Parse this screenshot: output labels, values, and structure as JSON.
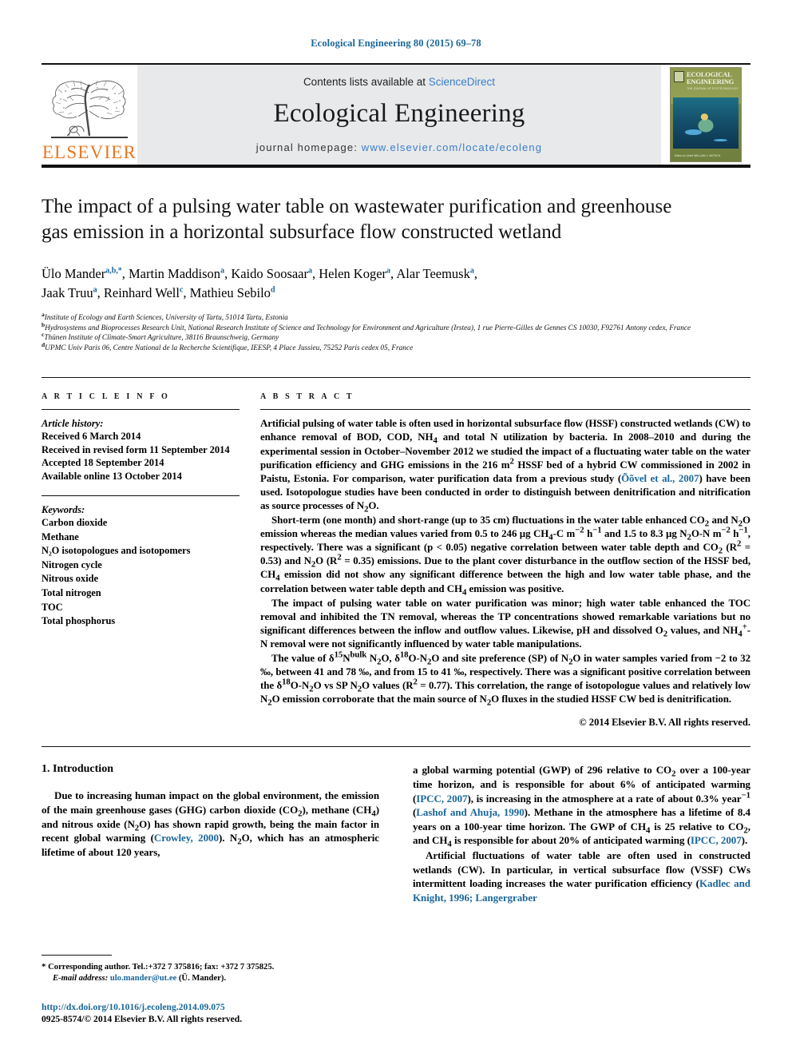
{
  "running_head": "Ecological Engineering 80 (2015) 69–78",
  "masthead": {
    "publisher_name": "ELSEVIER",
    "contents_prefix": "Contents lists available at ",
    "contents_link": "ScienceDirect",
    "journal_title": "Ecological Engineering",
    "homepage_prefix": "journal homepage: ",
    "homepage_url": "www.elsevier.com/locate/ecoleng",
    "cover": {
      "title_line1": "ECOLOGICAL",
      "title_line2": "ENGINEERING",
      "subtitle": "THE JOURNAL OF ECOTECHNOLOGY",
      "footer": "Editor-in-Chief\nWILLIAM J. MITSCH"
    }
  },
  "article": {
    "title": "The impact of a pulsing water table on wastewater purification and greenhouse gas emission in a horizontal subsurface flow constructed wetland",
    "authors": [
      {
        "name": "Ülo Mander",
        "marks": "a,b,*"
      },
      {
        "name": "Martin Maddison",
        "marks": "a"
      },
      {
        "name": "Kaido Soosaar",
        "marks": "a"
      },
      {
        "name": "Helen Koger",
        "marks": "a"
      },
      {
        "name": "Alar Teemusk",
        "marks": "a"
      },
      {
        "name": "Jaak Truu",
        "marks": "a"
      },
      {
        "name": "Reinhard Well",
        "marks": "c"
      },
      {
        "name": "Mathieu Sebilo",
        "marks": "d"
      }
    ],
    "affiliations": [
      {
        "mark": "a",
        "text": "Institute of Ecology and Earth Sciences, University of Tartu, 51014 Tartu, Estonia"
      },
      {
        "mark": "b",
        "text": "Hydrosystems and Bioprocesses Research Unit, National Research Institute of Science and Technology for Environment and Agriculture (Irstea), 1 rue Pierre-Gilles de Gennes CS 10030, F92761 Antony cedex, France"
      },
      {
        "mark": "c",
        "text": "Thünen Institute of Climate-Smart Agriculture, 38116 Braunschweig, Germany"
      },
      {
        "mark": "d",
        "text": "UPMC Univ Paris 06, Centre National de la Recherche Scientifique, IEESP, 4 Place Jussieu, 75252 Paris cedex 05, France"
      }
    ]
  },
  "article_info": {
    "heading": "A R T I C L E   I N F O",
    "history_label": "Article history:",
    "history": [
      "Received 6 March 2014",
      "Received in revised form 11 September 2014",
      "Accepted 18 September 2014",
      "Available online 13 October 2014"
    ],
    "keywords_label": "Keywords:",
    "keywords": [
      "Carbon dioxide",
      "Methane",
      "N₂O isotopologues and isotopomers",
      "Nitrogen cycle",
      "Nitrous oxide",
      "Total nitrogen",
      "TOC",
      "Total phosphorus"
    ]
  },
  "abstract": {
    "heading": "A B S T R A C T",
    "paragraphs": [
      "Artificial pulsing of water table is often used in horizontal subsurface flow (HSSF) constructed wetlands (CW) to enhance removal of BOD, COD, NH4 and total N utilization by bacteria. In 2008–2010 and during the experimental session in October–November 2012 we studied the impact of a fluctuating water table on the water purification efficiency and GHG emissions in the 216 m2 HSSF bed of a hybrid CW commissioned in 2002 in Paistu, Estonia. For comparison, water purification data from a previous study (Õõvel et al., 2007) have been used. Isotopologue studies have been conducted in order to distinguish between denitrification and nitrification as source processes of N2O.",
      "Short-term (one month) and short-range (up to 35 cm) fluctuations in the water table enhanced CO2 and N2O emission whereas the median values varied from 0.5 to 246 µg CH4-C m−2 h−1 and 1.5 to 8.3 µg N2O-N m−2 h−1, respectively. There was a significant (p < 0.05) negative correlation between water table depth and CO2 (R2 = 0.53) and N2O (R2 = 0.35) emissions. Due to the plant cover disturbance in the outflow section of the HSSF bed, CH4 emission did not show any significant difference between the high and low water table phase, and the correlation between water table depth and CH4 emission was positive.",
      "The impact of pulsing water table on water purification was minor; high water table enhanced the TOC removal and inhibited the TN removal, whereas the TP concentrations showed remarkable variations but no significant differences between the inflow and outflow values. Likewise, pH and dissolved O2 values, and NH4+-N removal were not significantly influenced by water table manipulations.",
      "The value of δ15Nbulk N2O, δ18O-N2O and site preference (SP) of N2O in water samples varied from −2 to 32 ‰, between 41 and 78 ‰, and from 15 to 41 ‰, respectively. There was a significant positive correlation between the δ18O-N2O vs SP N2O values (R2 = 0.77). This correlation, the range of isotopologue values and relatively low N2O emission corroborate that the main source of N2O fluxes in the studied HSSF CW bed is denitrification."
    ],
    "inline_citation": "Õõvel et al., 2007",
    "copyright": "© 2014 Elsevier B.V. All rights reserved."
  },
  "introduction": {
    "heading": "1. Introduction",
    "left_paragraph": "Due to increasing human impact on the global environment, the emission of the main greenhouse gases (GHG) carbon dioxide (CO2), methane (CH4) and nitrous oxide (N2O) has shown rapid growth, being the main factor in recent global warming (Crowley, 2000). N2O, which has an atmospheric lifetime of about 120 years,",
    "right_paragraph_1": "a global warming potential (GWP) of 296 relative to CO2 over a 100-year time horizon, and is responsible for about 6% of anticipated warming (IPCC, 2007), is increasing in the atmosphere at a rate of about 0.3% year−1 (Lashof and Ahuja, 1990). Methane in the atmosphere has a lifetime of 8.4 years on a 100-year time horizon. The GWP of CH4 is 25 relative to CO2, and CH4 is responsible for about 20% of anticipated warming (IPCC, 2007).",
    "right_paragraph_2": "Artificial fluctuations of water table are often used in constructed wetlands (CW). In particular, in vertical subsurface flow (VSSF) CWs intermittent loading increases the water purification efficiency (Kadlec and Knight, 1996; Langergraber",
    "citations": {
      "crowley": "Crowley, 2000",
      "ipcc": "IPCC, 2007",
      "lashof": "Lashof and Ahuja, 1990",
      "kadlec": "Kadlec and Knight, 1996; Langergraber"
    }
  },
  "footer": {
    "corresponding_marker": "*",
    "corresponding": "Corresponding author. Tel.:+372 7 375816; fax: +372 7 375825.",
    "email_label": "E-mail address:",
    "email": "ulo.mander@ut.ee",
    "email_owner": "(Ü. Mander).",
    "doi": "http://dx.doi.org/10.1016/j.ecoleng.2014.09.075",
    "issn_line": "0925-8574/© 2014 Elsevier B.V. All rights reserved."
  },
  "colors": {
    "link": "#1a6699",
    "sciencedirect": "#3a7dc9",
    "elsevier_orange": "#e87722",
    "banner_bg": "#e8e9ea"
  }
}
